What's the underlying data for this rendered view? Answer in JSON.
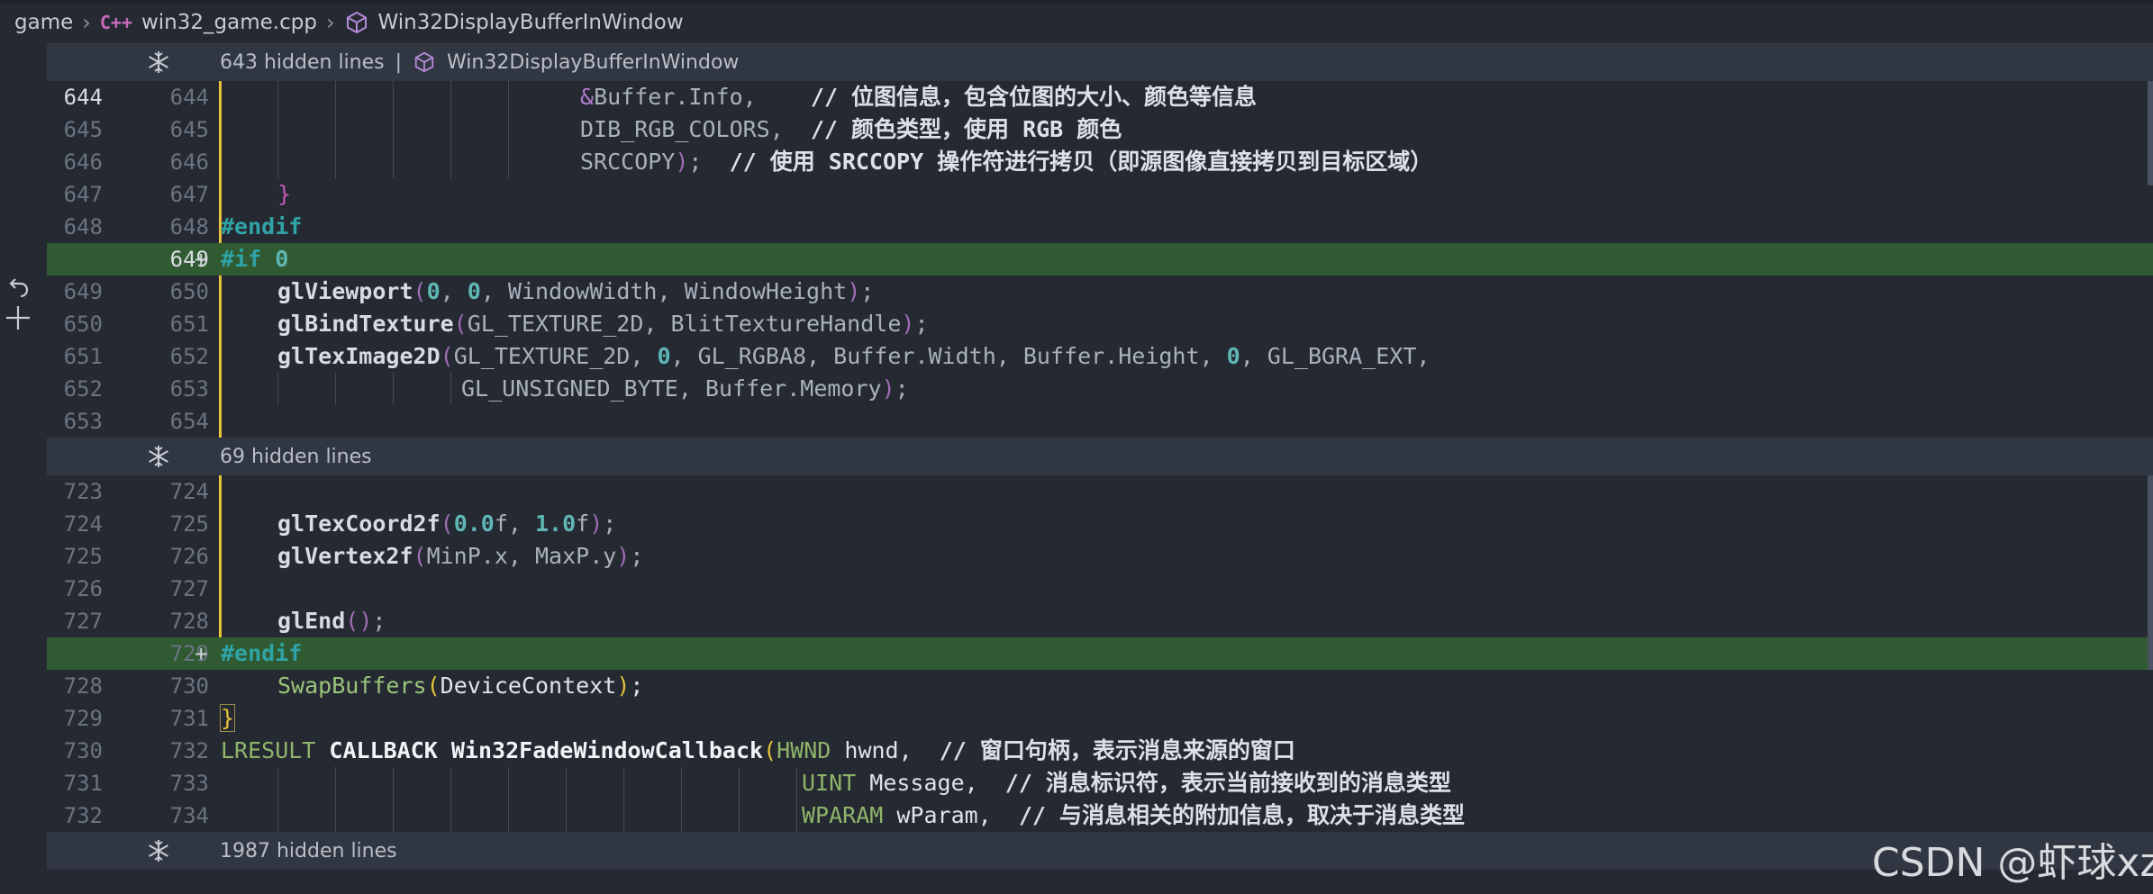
{
  "breadcrumb": {
    "items": [
      {
        "label": "game"
      },
      {
        "label": "win32_game.cpp",
        "icon": "cpp-file-icon"
      },
      {
        "label": "Win32DisplayBufferInWindow",
        "icon": "method-cube-icon"
      }
    ]
  },
  "folds": [
    {
      "text": "643 hidden lines",
      "context": "Win32DisplayBufferInWindow"
    },
    {
      "text": "69 hidden lines"
    },
    {
      "text": "1987 hidden lines"
    }
  ],
  "lines": [
    {
      "old": "644",
      "new": "644",
      "code": "&Buffer.Info,    // 位图信息，包含位图的大小、颜色等信息"
    },
    {
      "old": "645",
      "new": "645",
      "code": "DIB_RGB_COLORS,  // 颜色类型，使用 RGB 颜色"
    },
    {
      "old": "646",
      "new": "646",
      "code": "SRCCOPY);  // 使用 SRCCOPY 操作符进行拷贝（即源图像直接拷贝到目标区域）"
    },
    {
      "old": "647",
      "new": "647",
      "code": "}"
    },
    {
      "old": "648",
      "new": "648",
      "code": "#endif"
    },
    {
      "old": "",
      "new": "649",
      "added": true,
      "code": "#if 0"
    },
    {
      "old": "649",
      "new": "650",
      "code": "glViewport(0, 0, WindowWidth, WindowHeight);"
    },
    {
      "old": "650",
      "new": "651",
      "code": "glBindTexture(GL_TEXTURE_2D, BlitTextureHandle);"
    },
    {
      "old": "651",
      "new": "652",
      "code": "glTexImage2D(GL_TEXTURE_2D, 0, GL_RGBA8, Buffer.Width, Buffer.Height, 0, GL_BGRA_EXT,"
    },
    {
      "old": "652",
      "new": "653",
      "code": "GL_UNSIGNED_BYTE, Buffer.Memory);"
    },
    {
      "old": "653",
      "new": "654",
      "code": ""
    },
    {
      "old": "723",
      "new": "724",
      "code": ""
    },
    {
      "old": "724",
      "new": "725",
      "code": "glTexCoord2f(0.0f, 1.0f);"
    },
    {
      "old": "725",
      "new": "726",
      "code": "glVertex2f(MinP.x, MaxP.y);"
    },
    {
      "old": "726",
      "new": "727",
      "code": ""
    },
    {
      "old": "727",
      "new": "728",
      "code": "glEnd();"
    },
    {
      "old": "",
      "new": "729",
      "added": true,
      "code": "#endif"
    },
    {
      "old": "728",
      "new": "730",
      "code": "SwapBuffers(DeviceContext);"
    },
    {
      "old": "729",
      "new": "731",
      "code": "}"
    },
    {
      "old": "730",
      "new": "732",
      "code": "LRESULT CALLBACK Win32FadeWindowCallback(HWND hwnd,  // 窗口句柄，表示消息来源的窗口"
    },
    {
      "old": "731",
      "new": "733",
      "code": "UINT Message,  // 消息标识符，表示当前接收到的消息类型"
    },
    {
      "old": "732",
      "new": "734",
      "code": "WPARAM wParam,  // 与消息相关的附加信息，取决于消息类型"
    }
  ],
  "watermark": "CSDN @虾球xz",
  "colors": {
    "background": "#252a32",
    "fold_bar": "#313742",
    "added_line": "#2f5a32",
    "modified_marker": "#e9c33a"
  }
}
